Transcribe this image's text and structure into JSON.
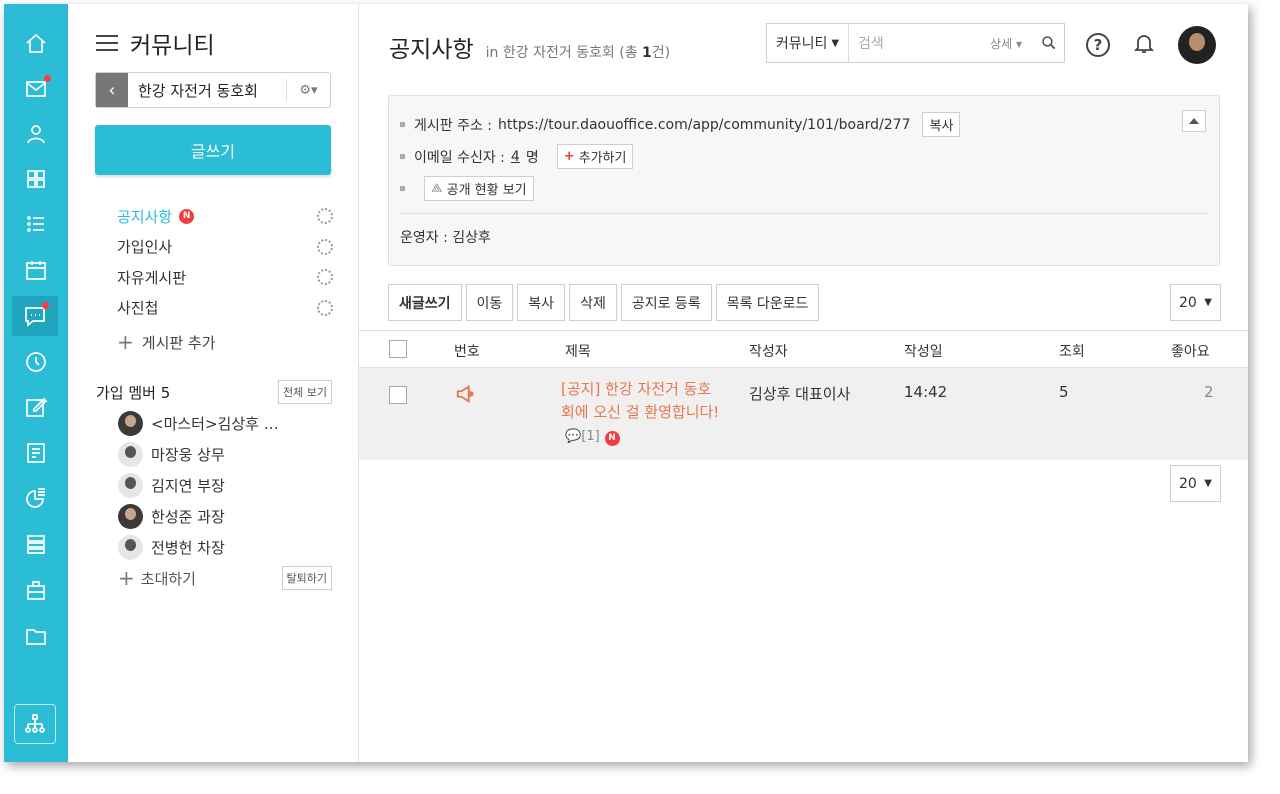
{
  "sidebar_title": "커뮤니티",
  "community_name": "한강 자전거 동호회",
  "write_label": "글쓰기",
  "boards": [
    {
      "label": "공지사항",
      "badge": "N"
    },
    {
      "label": "가입인사"
    },
    {
      "label": "자유게시판"
    },
    {
      "label": "사진첩"
    }
  ],
  "add_board_label": "게시판 추가",
  "members_header": "가입 멤버 5",
  "view_all_label": "전체 보기",
  "members": [
    "<마스터>김상후 …",
    "마장웅 상무",
    "김지연 부장",
    "한성준 과장",
    "전병헌 차장"
  ],
  "invite_label": "초대하기",
  "leave_label": "탈퇴하기",
  "page_title": "공지사항",
  "page_sub_prefix": "in 한강 자전거 동호회 (총 ",
  "page_sub_count": "1",
  "page_sub_suffix": "건)",
  "search": {
    "scope": "커뮤니티",
    "placeholder": "검색",
    "advanced": "상세"
  },
  "info": {
    "address_label": "게시판 주소 :",
    "address_value": "https://tour.daouoffice.com/app/community/101/board/277",
    "copy_label": "복사",
    "email_label": "이메일 수신자 :",
    "email_count": "4",
    "email_unit": "명",
    "add_label": "추가하기",
    "public_label": "공개 현황 보기",
    "operator": "운영자 : 김상후"
  },
  "toolbar": [
    "새글쓰기",
    "이동",
    "복사",
    "삭제",
    "공지로 등록",
    "목록 다운로드"
  ],
  "page_size": "20",
  "columns": {
    "no": "번호",
    "title": "제목",
    "author": "작성자",
    "date": "작성일",
    "views": "조회",
    "likes": "좋아요"
  },
  "rows": [
    {
      "title": "[공지] 한강 자전거 동호회에 오신 걸 환영합니다!",
      "comments": "[1]",
      "badge": "N",
      "author": "김상후 대표이사",
      "date": "14:42",
      "views": "5",
      "likes": "2"
    }
  ],
  "colors": {
    "brand": "#2bbcd6",
    "notice": "#e8774d",
    "badge": "#f23c3c"
  },
  "rail_icons": [
    "home-icon",
    "mail-icon",
    "contacts-icon",
    "apps-icon",
    "list-icon",
    "calendar-icon",
    "community-icon",
    "clock-icon",
    "edit-icon",
    "report-icon",
    "survey-icon",
    "docs-icon",
    "asset-icon",
    "folder-icon",
    "org-chart-icon"
  ]
}
